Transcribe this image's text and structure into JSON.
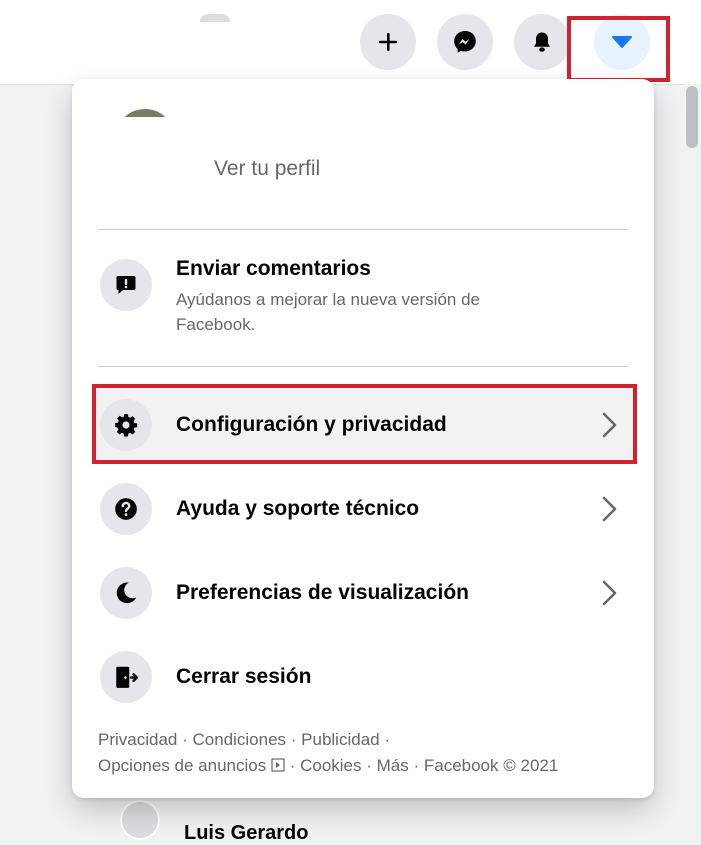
{
  "topbar": {
    "buttons": [
      {
        "name": "create",
        "icon": "plus-icon"
      },
      {
        "name": "messenger",
        "icon": "messenger-icon"
      },
      {
        "name": "notifications",
        "icon": "bell-icon"
      },
      {
        "name": "account",
        "icon": "caret-down-icon"
      }
    ]
  },
  "menu": {
    "profile_link": "Ver tu perfil",
    "feedback": {
      "title": "Enviar comentarios",
      "subtitle": "Ayúdanos a mejorar la nueva versión de Facebook."
    },
    "items": [
      {
        "label": "Configuración y privacidad",
        "icon": "gear-icon"
      },
      {
        "label": "Ayuda y soporte técnico",
        "icon": "question-icon"
      },
      {
        "label": "Preferencias de visualización",
        "icon": "moon-icon"
      },
      {
        "label": "Cerrar sesión",
        "icon": "logout-icon"
      }
    ],
    "footer": {
      "links": [
        "Privacidad",
        "Condiciones",
        "Publicidad",
        "Opciones de anuncios",
        "Cookies",
        "Más"
      ],
      "separator": " · ",
      "copyright": "Facebook © 2021"
    }
  },
  "behind": {
    "contact_name": "Luis Gerardo"
  },
  "colors": {
    "highlight": "#d0222f",
    "accent": "#1877f2"
  }
}
